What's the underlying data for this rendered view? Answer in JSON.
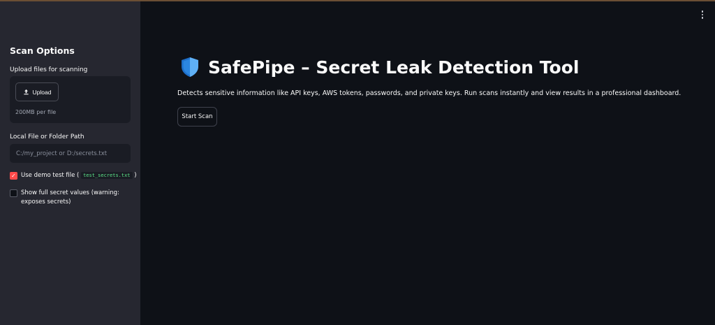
{
  "sidebar": {
    "title": "Scan Options",
    "upload_label": "Upload files for scanning",
    "upload_button": "Upload",
    "upload_limit": "200MB per file",
    "path_label": "Local File or Folder Path",
    "path_placeholder": "C:/my_project or D:/secrets.txt",
    "demo_checkbox": {
      "label": "Use demo test file (",
      "code": "test_secrets.txt",
      "label_end": ")",
      "checked": true
    },
    "show_secrets_checkbox": {
      "label_line1": "Show full secret values (warning:",
      "label_line2": "exposes secrets)",
      "checked": false
    }
  },
  "main": {
    "title": "SafePipe – Secret Leak Detection Tool",
    "description": "Detects sensitive information like API keys, AWS tokens, passwords, and private keys. Run scans instantly and view results in a professional dashboard.",
    "start_button": "Start Scan"
  },
  "colors": {
    "accent": "#ff4b4b",
    "background": "#0e1117",
    "sidebar": "#262730",
    "code": "#5ce488"
  }
}
